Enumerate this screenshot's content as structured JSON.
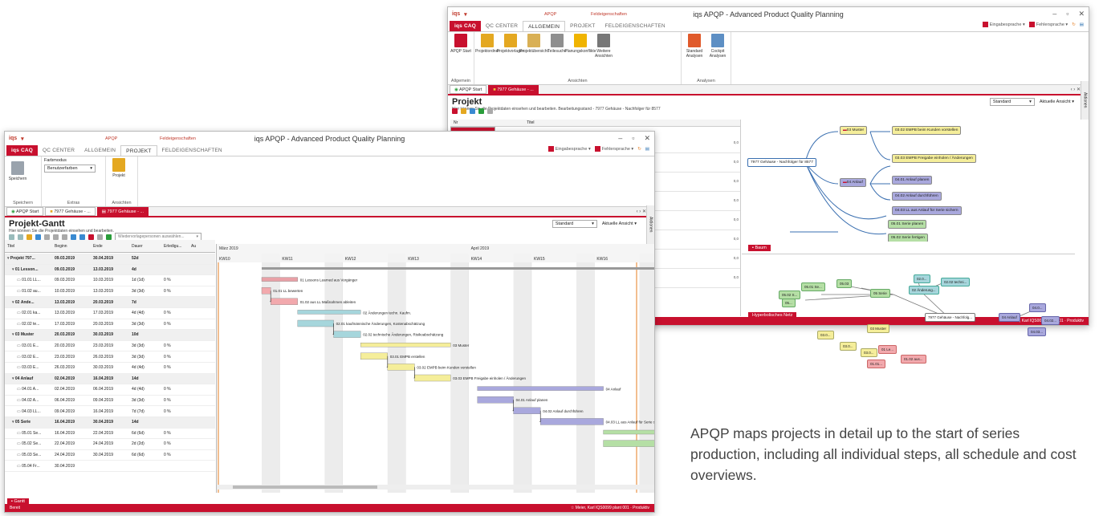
{
  "caption": "APQP maps projects in detail up to the start of series production, including all individual steps, all schedule and cost overviews.",
  "back_window": {
    "title": "iqs APQP - Advanced Product Quality Planning",
    "ctx_left": "APQP",
    "ctx_right": "Feldeigenschaften",
    "tabs": [
      "iqs CAQ",
      "QC CENTER",
      "ALLGEMEIN",
      "PROJEKT",
      "FELDEIGENSCHAFTEN"
    ],
    "lang1": "Eingabesprache",
    "lang2": "Fehlersprache",
    "ribbon_groups": [
      {
        "name": "Allgemein",
        "buttons": [
          {
            "label": "APQP Start",
            "color": "#c8102e"
          }
        ]
      },
      {
        "name": "Ansichten",
        "buttons": [
          {
            "label": "Projektordner",
            "color": "#e4a821"
          },
          {
            "label": "Projektvorlagen",
            "color": "#e4a821"
          },
          {
            "label": "Projektübersicht",
            "color": "#d9b055"
          },
          {
            "label": "Teilesuche",
            "color": "#8f8f8f"
          },
          {
            "label": "Planungskonflikte",
            "color": "#f0b400"
          },
          {
            "label": "Weitere Ansichten",
            "color": "#777777"
          }
        ]
      },
      {
        "name": "Analysen",
        "buttons": [
          {
            "label": "Standard Analysen",
            "color": "#e05a2b"
          },
          {
            "label": "Cockpit Analysen",
            "color": "#5d8fc4"
          }
        ]
      }
    ],
    "doc_tabs": [
      "APQP Start",
      "7977 Gehäuse - ..."
    ],
    "page_title": "Projekt",
    "page_sub": "Hier können Sie die Projektdaten einsehen und bearbeiten. Bearbeitungsstand - 7977 Gehäuse - Nachfolger für 8577",
    "view_select": "Standard",
    "view_current": "Aktuelle Ansicht",
    "side_tab": "Aktionen",
    "list_header": [
      "Nr",
      "Titel"
    ],
    "list_values": [
      "0,0",
      "0,0",
      "0,0",
      "0,0",
      "0,0",
      "0,0",
      "0,0",
      "0,0"
    ],
    "mindmap": {
      "root": "7977 Gehäuse - Nachfolger für 8577",
      "muster": "03 Muster",
      "m1": "03.02 EMPB beim Kunden vorstellen",
      "m2": "03.03 EMPB Freigabe einholen / Änderungen",
      "anlauf": "04 Anlauf",
      "a1": "04.01 Anlauf planen",
      "a2": "04.02 Anlauf durchführen",
      "a3": "04.03 LL aus Anlauf für Serie sichern",
      "s1": "05.01 Serie planen",
      "s2": "05.02 Serie fertigen"
    },
    "tree_tab": "Baum",
    "net_tab": "Hyperbolisches Netz",
    "tree": {
      "center": "7977 Gehäuse - Nachfolg...",
      "n_serie": "05 Serie",
      "n_aenderung": "02 Änderung...",
      "n_anlauf": "04 Anlauf",
      "n_muster": "03 Muster",
      "n_le": "01 Le...",
      "n1": "05.01 Se...",
      "n2": "05.02 S...",
      "n3": "05.03",
      "n4": "05...",
      "n5": "02.0...",
      "n6": "02.02 techni...",
      "n7": "04.0...",
      "n8": "04.02...",
      "n9": "04.03...",
      "n10": "03.0...",
      "n11": "03.0...",
      "n12": "03.0...",
      "n13": "01.01...",
      "n14": "01.02 aus..."
    },
    "status_user": "Meier, Karl IQS0099 plant 001",
    "status_right": "Produktiv"
  },
  "front_window": {
    "title": "iqs APQP - Advanced Product Quality Planning",
    "ctx_left": "APQP",
    "ctx_right": "Feldeigenschaften",
    "tabs": [
      "iqs CAQ",
      "QC CENTER",
      "ALLGEMEIN",
      "PROJEKT",
      "FELDEIGENSCHAFTEN"
    ],
    "lang1": "Eingabesprache",
    "lang2": "Fehlersprache",
    "ribbon": {
      "save": "Speichern",
      "group_save": "Speichern",
      "farbmodus": "Farbmodus",
      "farbmodus_value": "Benutzerfarben",
      "group_extras": "Extras",
      "projekt": "Projekt",
      "group_ansichten": "Ansichten"
    },
    "doc_tabs": [
      "APQP Start",
      "7977 Gehäuse - ...",
      "7977 Gehäuse - ..."
    ],
    "page_title": "Projekt-Gantt",
    "page_sub": "Hier können Sie die Projektdaten einsehen und bearbeiten.",
    "view_select": "Standard",
    "view_current": "Aktuelle Ansicht",
    "side_tab": "Aktionen",
    "filter_placeholder": "Wiedervorlagepersonen auswählen...",
    "columns": [
      "Titel",
      "Beginn",
      "Ende",
      "Dauer",
      "Erledigu...",
      "Au"
    ],
    "rows": [
      {
        "title": "Projekt 797...",
        "start": "09.03.2019",
        "end": "30.04.2019",
        "dur": "52d",
        "pct": "",
        "level": 0,
        "bold": true
      },
      {
        "title": "01 Lesson...",
        "start": "09.03.2019",
        "end": "13.03.2019",
        "dur": "4d",
        "pct": "",
        "level": 1,
        "bold": true
      },
      {
        "title": "01.01 LL...",
        "start": "09.03.2019",
        "end": "10.03.2019",
        "dur": "1d (1d)",
        "pct": "0 %",
        "level": 2,
        "bold": false
      },
      {
        "title": "01.02 au...",
        "start": "10.03.2019",
        "end": "13.03.2019",
        "dur": "3d (3d)",
        "pct": "0 %",
        "level": 2,
        "bold": false
      },
      {
        "title": "02 Ände...",
        "start": "13.03.2019",
        "end": "20.03.2019",
        "dur": "7d",
        "pct": "",
        "level": 1,
        "bold": true
      },
      {
        "title": "02.01 ka...",
        "start": "13.03.2019",
        "end": "17.03.2019",
        "dur": "4d (4d)",
        "pct": "0 %",
        "level": 2,
        "bold": false
      },
      {
        "title": "02.02 te...",
        "start": "17.03.2019",
        "end": "20.03.2019",
        "dur": "3d (3d)",
        "pct": "0 %",
        "level": 2,
        "bold": false
      },
      {
        "title": "03 Muster",
        "start": "20.03.2019",
        "end": "30.03.2019",
        "dur": "10d",
        "pct": "",
        "level": 1,
        "bold": true
      },
      {
        "title": "03.01 E...",
        "start": "20.03.2019",
        "end": "23.03.2019",
        "dur": "3d (3d)",
        "pct": "0 %",
        "level": 2,
        "bold": false
      },
      {
        "title": "03.02 E...",
        "start": "23.03.2019",
        "end": "26.03.2019",
        "dur": "3d (3d)",
        "pct": "0 %",
        "level": 2,
        "bold": false
      },
      {
        "title": "03.03 E...",
        "start": "26.03.2019",
        "end": "30.03.2019",
        "dur": "4d (4d)",
        "pct": "0 %",
        "level": 2,
        "bold": false
      },
      {
        "title": "04 Anlauf",
        "start": "02.04.2019",
        "end": "16.04.2019",
        "dur": "14d",
        "pct": "",
        "level": 1,
        "bold": true
      },
      {
        "title": "04.01 A...",
        "start": "02.04.2019",
        "end": "06.04.2019",
        "dur": "4d (4d)",
        "pct": "0 %",
        "level": 2,
        "bold": false
      },
      {
        "title": "04.02 A...",
        "start": "06.04.2019",
        "end": "09.04.2019",
        "dur": "3d (3d)",
        "pct": "0 %",
        "level": 2,
        "bold": false
      },
      {
        "title": "04.03 LL...",
        "start": "09.04.2019",
        "end": "16.04.2019",
        "dur": "7d (7d)",
        "pct": "0 %",
        "level": 2,
        "bold": false
      },
      {
        "title": "05 Serie",
        "start": "16.04.2019",
        "end": "30.04.2019",
        "dur": "14d",
        "pct": "",
        "level": 1,
        "bold": true
      },
      {
        "title": "05.01 Se...",
        "start": "16.04.2019",
        "end": "22.04.2019",
        "dur": "6d (6d)",
        "pct": "0 %",
        "level": 2,
        "bold": false
      },
      {
        "title": "05.02 Se...",
        "start": "22.04.2019",
        "end": "24.04.2019",
        "dur": "2d (2d)",
        "pct": "0 %",
        "level": 2,
        "bold": false
      },
      {
        "title": "05.03 Se...",
        "start": "24.04.2019",
        "end": "30.04.2019",
        "dur": "6d (6d)",
        "pct": "0 %",
        "level": 2,
        "bold": false
      },
      {
        "title": "05.04 Fr...",
        "start": "30.04.2019",
        "end": "",
        "dur": "",
        "pct": "",
        "level": 2,
        "bold": false
      }
    ],
    "months": [
      "März 2019",
      "April 2019"
    ],
    "weeks": [
      "KW10",
      "KW11",
      "KW12",
      "KW13",
      "KW14",
      "KW15",
      "KW16",
      "KW17",
      "KW18"
    ],
    "bars": [
      {
        "label": "",
        "start_day": 0,
        "len": 0,
        "color": ""
      },
      {
        "label": "01 Lessons Learned aus Vorgänger",
        "color": "#e8a0a6"
      },
      {
        "label": "01.01 LL bewerten",
        "color": "#f2a9ad"
      },
      {
        "label": "01.02 aus LL Maßnahmen ableiten",
        "color": "#f2a9ad"
      },
      {
        "label": "02 Änderungen techn. Kaufm.",
        "color": "#a6d6dc"
      },
      {
        "label": "02.01 kaufmännische Änderungen, Kostenabschätzung",
        "color": "#a6d6dc"
      },
      {
        "label": "02.02 technische Änderungen, Risikoabschätzung",
        "color": "#a6d6dc"
      },
      {
        "label": "03 Muster",
        "color": "#f5ee9a"
      },
      {
        "label": "03.01 EMPB erstellen",
        "color": "#f5ee9a"
      },
      {
        "label": "03.02 EMPB beim Kunden vorstellen",
        "color": "#f5ee9a"
      },
      {
        "label": "03.03 EMPB Freigabe einholen / Änderungen",
        "color": "#f5ee9a"
      },
      {
        "label": "04 Anlauf",
        "color": "#a9a8dd"
      },
      {
        "label": "04.01 Anlauf planen",
        "color": "#a9a8dd"
      },
      {
        "label": "04.02 Anlauf durchführen",
        "color": "#a9a8dd"
      },
      {
        "label": "04.03 LL aus Anlauf für Serie sichern",
        "color": "#a9a8dd"
      },
      {
        "label": "05",
        "color": "#b5dfa5"
      },
      {
        "label": "05.01 Serie planen",
        "color": "#b5dfa5"
      },
      {
        "label": "05.02 Serie fertigen",
        "color": "#b5dfa5"
      },
      {
        "label": "05.",
        "color": "#b5dfa5"
      },
      {
        "label": "",
        "color": "#b5dfa5"
      }
    ],
    "bottom_tab": "Gantt",
    "status_left": "Bereit",
    "status_user": "Meier, Karl IQS0099 plant 001",
    "status_right": "Produktiv"
  }
}
